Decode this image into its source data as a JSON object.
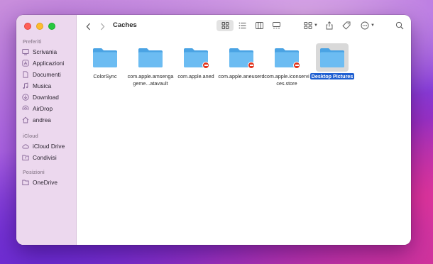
{
  "window": {
    "title": "Caches"
  },
  "sidebar": {
    "sections": [
      {
        "title": "Preferiti",
        "items": [
          {
            "label": "Scrivania",
            "icon": "desktop-icon"
          },
          {
            "label": "Applicazioni",
            "icon": "applications-icon"
          },
          {
            "label": "Documenti",
            "icon": "document-icon"
          },
          {
            "label": "Musica",
            "icon": "music-icon"
          },
          {
            "label": "Download",
            "icon": "download-icon"
          },
          {
            "label": "AirDrop",
            "icon": "airdrop-icon"
          },
          {
            "label": "andrea",
            "icon": "home-icon"
          }
        ]
      },
      {
        "title": "iCloud",
        "items": [
          {
            "label": "iCloud Drive",
            "icon": "cloud-icon"
          },
          {
            "label": "Condivisi",
            "icon": "shared-folder-icon"
          }
        ]
      },
      {
        "title": "Posizioni",
        "items": [
          {
            "label": "OneDrive",
            "icon": "folder-icon"
          }
        ]
      }
    ]
  },
  "files": [
    {
      "name": "ColorSync",
      "badge": false,
      "selected": false
    },
    {
      "name": "com.apple.amsengageme...atavault",
      "badge": false,
      "selected": false
    },
    {
      "name": "com.apple.aned",
      "badge": true,
      "selected": false
    },
    {
      "name": "com.apple.aneuserd",
      "badge": true,
      "selected": false
    },
    {
      "name": "com.apple.iconservices.store",
      "badge": true,
      "selected": false
    },
    {
      "name": "Desktop Pictures",
      "badge": false,
      "selected": true
    }
  ],
  "colors": {
    "folder": "#5cb3ee",
    "folder_top": "#7cc6f4",
    "selection": "#1f5fd1",
    "badge": "#e2341d"
  }
}
